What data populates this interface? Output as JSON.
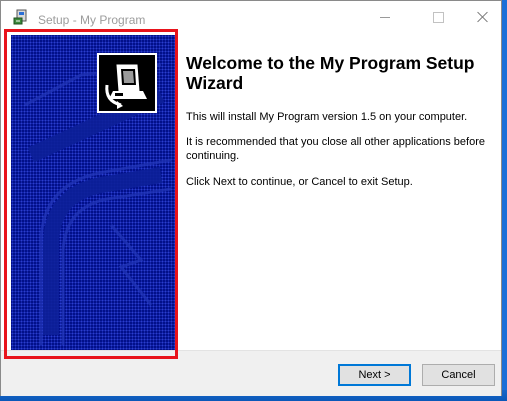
{
  "window": {
    "title": "Setup - My Program"
  },
  "content": {
    "heading": "Welcome to the My Program Setup Wizard",
    "install_text": "This will install My Program version 1.5 on your computer.",
    "recommend_text": "It is recommended that you close all other applications before continuing.",
    "instructions_text": "Click Next to continue, or Cancel to exit Setup."
  },
  "buttons": {
    "next_label": "Next >",
    "cancel_label": "Cancel"
  },
  "icons": {
    "app": "setup-app-icon",
    "minimize": "minimize-icon",
    "maximize": "maximize-icon",
    "close": "close-icon",
    "logo": "computer-install-icon"
  },
  "colors": {
    "wizard_image_bg": "#000f87",
    "highlight_border": "#e8131b",
    "default_button_border": "#0078d7"
  }
}
